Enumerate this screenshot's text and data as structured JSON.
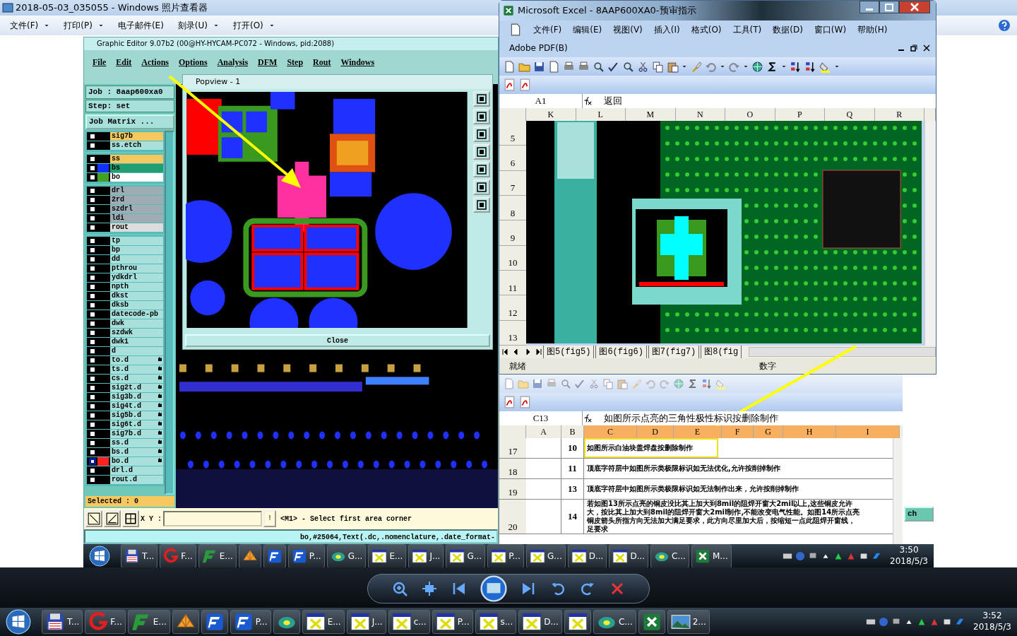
{
  "viewer": {
    "title": "2018-05-03_035055 - Windows 照片查看器",
    "menu": [
      {
        "label": "文件(F)",
        "dropdown": true
      },
      {
        "label": "打印(P)",
        "dropdown": true
      },
      {
        "label": "电子邮件(E)",
        "dropdown": false
      },
      {
        "label": "刻录(U)",
        "dropdown": true
      },
      {
        "label": "打开(O)",
        "dropdown": true
      }
    ]
  },
  "editor": {
    "title": "Graphic Editor 9.07b2 (00@HY-HYCAM-PC072 - Windows, pid:2088)",
    "menu": [
      "File",
      "Edit",
      "Actions",
      "Options",
      "Analysis",
      "DFM",
      "Step",
      "Rout",
      "Windows"
    ],
    "job": "Job : 8aap600xa0",
    "step": "Step: set",
    "matrix_button": "Job Matrix ...",
    "layer_groups": [
      [
        {
          "name": "sig7b",
          "color": "#f8c860",
          "selected": false,
          "flag": false
        },
        {
          "name": "ss.etch",
          "color": "#a8e0dc",
          "selected": false,
          "flag": false
        }
      ],
      [
        {
          "name": "ss",
          "color": "#f8c860",
          "selected": false,
          "flag": false
        },
        {
          "name": "bs",
          "color": "#20a070",
          "swatch": {
            "color": "#1030ff"
          },
          "selected": false,
          "flag": false
        },
        {
          "name": "bo",
          "color": "#ffffff",
          "swatch": {
            "color": "#40a020"
          },
          "selected": false,
          "flag": false
        }
      ],
      [
        {
          "name": "drl",
          "color": "#a0acb4",
          "selected": false,
          "flag": false
        },
        {
          "name": "2rd",
          "color": "#a0acb4",
          "selected": false,
          "flag": false
        },
        {
          "name": "szdrl",
          "color": "#a0acb4",
          "selected": false,
          "flag": false
        },
        {
          "name": "ldi",
          "color": "#a0acb4",
          "selected": false,
          "flag": false
        },
        {
          "name": "rout",
          "color": "#dcdcdc",
          "selected": false,
          "flag": false
        }
      ],
      [
        {
          "name": "tp",
          "color": "#a8e0dc",
          "selected": false,
          "flag": false
        },
        {
          "name": "bp",
          "color": "#a8e0dc",
          "selected": false,
          "flag": false
        },
        {
          "name": "dd",
          "color": "#a8e0dc",
          "selected": false,
          "flag": false
        },
        {
          "name": "pthrou",
          "color": "#a8e0dc",
          "selected": false,
          "flag": false
        },
        {
          "name": "ydkdrl",
          "color": "#a8e0dc",
          "selected": false,
          "flag": false
        },
        {
          "name": "npth",
          "color": "#a8e0dc",
          "selected": false,
          "flag": false
        },
        {
          "name": "dkst",
          "color": "#a8e0dc",
          "selected": false,
          "flag": false
        },
        {
          "name": "dksb",
          "color": "#a8e0dc",
          "selected": false,
          "flag": false
        },
        {
          "name": "datecode-pb",
          "color": "#a8e0dc",
          "selected": false,
          "flag": false
        },
        {
          "name": "dwk",
          "color": "#a8e0dc",
          "selected": false,
          "flag": false
        },
        {
          "name": "szdwk",
          "color": "#a8e0dc",
          "selected": false,
          "flag": false
        },
        {
          "name": "dwk1",
          "color": "#a8e0dc",
          "selected": false,
          "flag": false
        },
        {
          "name": "d",
          "color": "#a8e0dc",
          "selected": false,
          "flag": false
        },
        {
          "name": "to.d",
          "color": "#a8e0dc",
          "selected": false,
          "flag": true
        },
        {
          "name": "ts.d",
          "color": "#a8e0dc",
          "selected": false,
          "flag": true
        },
        {
          "name": "cs.d",
          "color": "#a8e0dc",
          "selected": false,
          "flag": true
        },
        {
          "name": "sig2t.d",
          "color": "#a8e0dc",
          "selected": false,
          "flag": true
        },
        {
          "name": "sig3b.d",
          "color": "#a8e0dc",
          "selected": false,
          "flag": true
        },
        {
          "name": "sig4t.d",
          "color": "#a8e0dc",
          "selected": false,
          "flag": true
        },
        {
          "name": "sig5b.d",
          "color": "#a8e0dc",
          "selected": false,
          "flag": true
        },
        {
          "name": "sig6t.d",
          "color": "#a8e0dc",
          "selected": false,
          "flag": true
        },
        {
          "name": "sig7b.d",
          "color": "#a8e0dc",
          "selected": false,
          "flag": true
        },
        {
          "name": "ss.d",
          "color": "#a8e0dc",
          "selected": false,
          "flag": true
        },
        {
          "name": "bs.d",
          "color": "#a8e0dc",
          "selected": false,
          "flag": true
        },
        {
          "name": "bo.d",
          "color": "#a8e0dc",
          "swatch": {
            "color": "#ff2020"
          },
          "selected": true,
          "flag": true
        },
        {
          "name": "drl.d",
          "color": "#a8e0dc",
          "selected": false,
          "flag": false
        },
        {
          "name": "rout.d",
          "color": "#a8e0dc",
          "selected": false,
          "flag": false
        }
      ]
    ],
    "selected_count": "Selected : 0",
    "xy_label": "X Y :",
    "warn_button": "!",
    "prompt": "<M1> - Select first area corner",
    "status": "bo,#25064,Text(.dc,.nomenclature,.date_format-"
  },
  "popview": {
    "title": "Popview - 1",
    "close": "Close"
  },
  "excel": {
    "title": "Microsoft Excel - 8AAP600XA0-预审指示",
    "menu": [
      "文件(F)",
      "编辑(E)",
      "视图(V)",
      "插入(I)",
      "格式(O)",
      "工具(T)",
      "数据(D)",
      "窗口(W)",
      "帮助(H)"
    ],
    "pdf_menu": "Adobe PDF(B)",
    "name_box": "A1",
    "formula": "返回",
    "columns": [
      "K",
      "L",
      "M",
      "N",
      "O",
      "P",
      "Q",
      "R"
    ],
    "rows": [
      "5",
      "6",
      "7",
      "8",
      "9",
      "10",
      "11",
      "12",
      "13"
    ],
    "sheet_tabs": [
      "图5(fig5)",
      "图6(fig6)",
      "图7(fig7)",
      "图8(fig"
    ],
    "status": "就绪",
    "num_indicator": "数字"
  },
  "excel2": {
    "name_box": "C13",
    "formula": "如图所示点亮的三角性极性标识按删除制作",
    "columns": [
      {
        "label": "A",
        "selected": false
      },
      {
        "label": "B",
        "selected": false
      },
      {
        "label": "C",
        "selected": true
      },
      {
        "label": "D",
        "selected": true
      },
      {
        "label": "E",
        "selected": true
      },
      {
        "label": "F",
        "selected": true
      },
      {
        "label": "G",
        "selected": true
      },
      {
        "label": "H",
        "selected": true
      },
      {
        "label": "I",
        "selected": true
      }
    ],
    "rows": [
      {
        "header": "17",
        "number": "10",
        "lines": [
          "如图所示白油块盖焊盘按删除制作"
        ],
        "highlighted": true
      },
      {
        "header": "18",
        "number": "11",
        "lines": [
          "顶底字符层中如图所示类极限标识如无法优化,允许按削掉制作"
        ],
        "highlighted": false
      },
      {
        "header": "19",
        "number": "13",
        "lines": [
          "顶底字符层中如图所示类极限标识如无法制作出来，允许按削掉制作"
        ],
        "highlighted": false
      },
      {
        "header": "20",
        "number": "14",
        "lines": [
          "若如图13所示点亮的铜皮没比其上加大到8mil的阻焊开窗大2mil以上,这些铜皮允许",
          "大，按比其上加大到8mil的阻焊开窗大2mil制作,不能改变电气性能。如图14所示点亮",
          "铜皮箭头所指方向无法加大满足要求，此方向尽里加大后，按缩短一点此阻焊开窗线，",
          "足要求"
        ],
        "highlighted": false
      }
    ]
  },
  "side_button": "ch",
  "inner_taskbar": {
    "items": [
      {
        "kind": "disk",
        "label": "T..."
      },
      {
        "kind": "glogo",
        "label": "F..."
      },
      {
        "kind": "fgreen",
        "label": "E..."
      },
      {
        "kind": "shell"
      },
      {
        "kind": "fblue"
      },
      {
        "kind": "fblue",
        "label": "P..."
      },
      {
        "kind": "disc",
        "label": "G..."
      },
      {
        "kind": "xwin",
        "label": "E..."
      },
      {
        "kind": "xwin",
        "label": "J..."
      },
      {
        "kind": "xwin",
        "label": "G..."
      },
      {
        "kind": "xwin",
        "label": "P..."
      },
      {
        "kind": "xwin",
        "label": "G..."
      },
      {
        "kind": "xwin",
        "label": "D..."
      },
      {
        "kind": "xwin",
        "label": "D..."
      },
      {
        "kind": "disc",
        "label": "C..."
      },
      {
        "kind": "excel",
        "label": "M..."
      }
    ],
    "time": "3:50",
    "date": "2018/5/3"
  },
  "taskbar": {
    "items": [
      {
        "kind": "disk",
        "label": "T..."
      },
      {
        "kind": "glogo",
        "label": "F..."
      },
      {
        "kind": "fgreen",
        "label": "E..."
      },
      {
        "kind": "shell"
      },
      {
        "kind": "fblue"
      },
      {
        "kind": "fblue",
        "label": "P..."
      },
      {
        "kind": "disc"
      },
      {
        "kind": "xwin",
        "label": "E..."
      },
      {
        "kind": "xwin",
        "label": "J..."
      },
      {
        "kind": "xwin",
        "label": "c..."
      },
      {
        "kind": "xwin",
        "label": "P..."
      },
      {
        "kind": "xwin",
        "label": "s..."
      },
      {
        "kind": "xwin",
        "label": "D..."
      },
      {
        "kind": "xwin"
      },
      {
        "kind": "disc",
        "label": "C..."
      },
      {
        "kind": "excel"
      },
      {
        "kind": "photo",
        "label": "2..."
      }
    ],
    "time": "3:52",
    "date": "2018/5/3"
  }
}
